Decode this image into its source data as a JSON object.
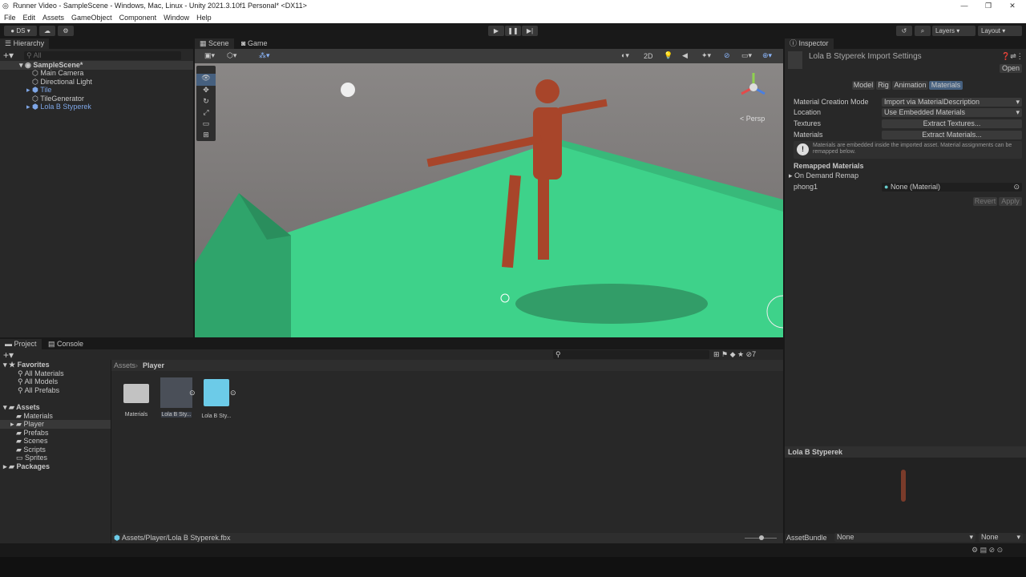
{
  "window": {
    "title": "Runner Video - SampleScene - Windows, Mac, Linux - Unity 2021.3.10f1 Personal* <DX11>"
  },
  "menu": [
    "File",
    "Edit",
    "Assets",
    "GameObject",
    "Component",
    "Window",
    "Help"
  ],
  "toolbar": {
    "account": "DS",
    "layers": "Layers",
    "layout": "Layout"
  },
  "hierarchy": {
    "title": "Hierarchy",
    "search_placeholder": "All",
    "scene": "SampleScene*",
    "items": [
      {
        "label": "Main Camera",
        "prefab": false
      },
      {
        "label": "Directional Light",
        "prefab": false
      },
      {
        "label": "Tile",
        "prefab": true
      },
      {
        "label": "TileGenerator",
        "prefab": false
      },
      {
        "label": "Lola B Styperek",
        "prefab": true
      }
    ]
  },
  "scene": {
    "tabs": [
      "Scene",
      "Game"
    ],
    "mode_2d": "2D",
    "persp": "< Persp"
  },
  "inspector": {
    "title": "Inspector",
    "asset_title": "Lola B Styperek Import Settings",
    "open": "Open",
    "tabs": [
      "Model",
      "Rig",
      "Animation",
      "Materials"
    ],
    "fields": [
      {
        "label": "Material Creation Mode",
        "value": "Import via MaterialDescription"
      },
      {
        "label": "Location",
        "value": "Use Embedded Materials"
      }
    ],
    "textures_label": "Textures",
    "textures_button": "Extract Textures...",
    "materials_label": "Materials",
    "materials_button": "Extract Materials...",
    "info": "Materials are embedded inside the imported asset. Material assignments can be remapped below.",
    "remapped_header": "Remapped Materials",
    "on_demand": "On Demand Remap",
    "phong_label": "phong1",
    "phong_value": "None (Material)",
    "revert": "Revert",
    "apply": "Apply",
    "preview_title": "Lola B Styperek",
    "assetbundle_label": "AssetBundle",
    "assetbundle_value": "None",
    "variant_value": "None"
  },
  "project": {
    "tabs": [
      "Project",
      "Console"
    ],
    "favorites": "Favorites",
    "fav_items": [
      "All Materials",
      "All Models",
      "All Prefabs"
    ],
    "assets": "Assets",
    "asset_folders": [
      "Materials",
      "Player",
      "Prefabs",
      "Scenes",
      "Scripts",
      "Sprites"
    ],
    "packages": "Packages",
    "breadcrumb": [
      "Assets",
      "Player"
    ],
    "grid": [
      "Materials",
      "Lola B Sty...",
      "Lola B Sty..."
    ],
    "path": "Assets/Player/Lola B Styperek.fbx",
    "badge": "7"
  }
}
